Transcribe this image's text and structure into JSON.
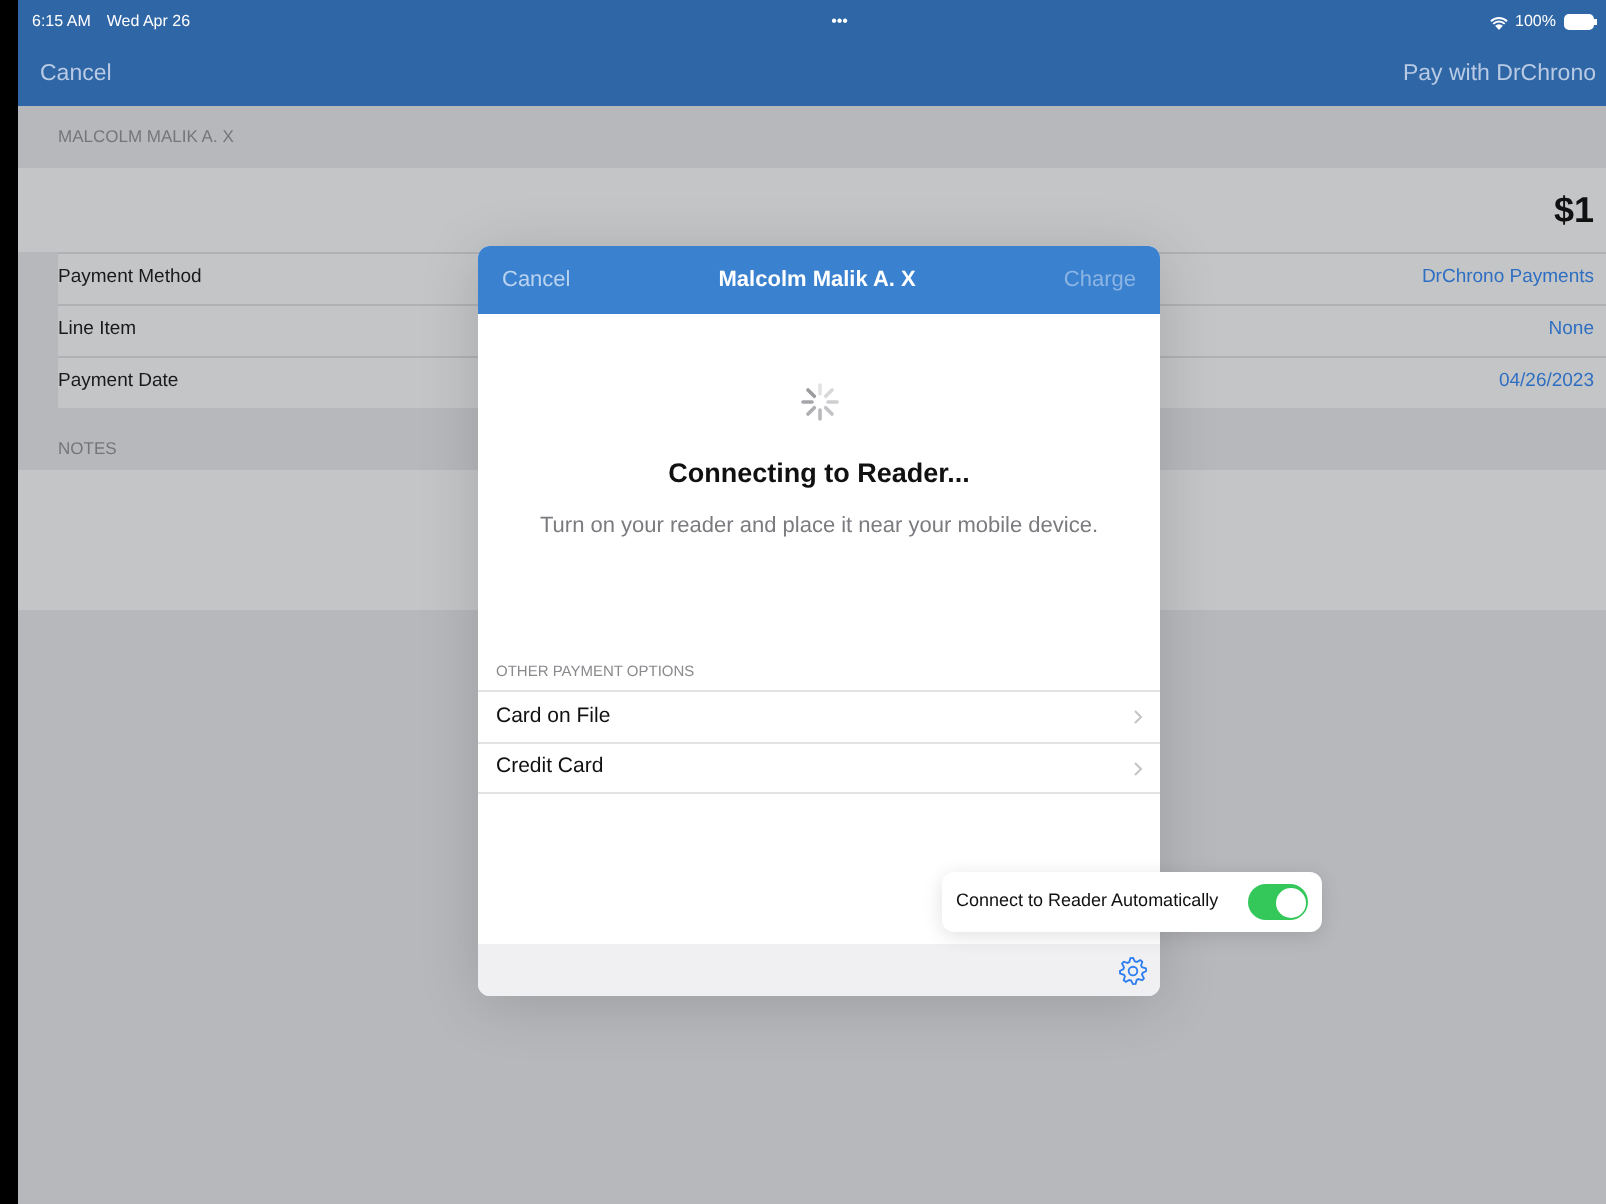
{
  "status_bar": {
    "time": "6:15 AM",
    "date": "Wed Apr 26",
    "dots": "•••",
    "battery": "100%"
  },
  "nav": {
    "cancel": "Cancel",
    "action": "Pay with DrChrono"
  },
  "patient_header": "MALCOLM MALIK A. X",
  "amount": "$1",
  "fields": [
    {
      "label": "Payment Method",
      "value": "DrChrono Payments"
    },
    {
      "label": "Line Item",
      "value": "None"
    },
    {
      "label": "Payment Date",
      "value": "04/26/2023"
    }
  ],
  "notes_header": "NOTES",
  "modal": {
    "cancel": "Cancel",
    "title": "Malcolm Malik A. X",
    "charge": "Charge",
    "charge_disabled": true,
    "heading": "Connecting to Reader...",
    "message": "Turn on your reader and place it near your mobile device.",
    "options_header": "OTHER PAYMENT OPTIONS",
    "options": [
      {
        "label": "Card on File"
      },
      {
        "label": "Credit Card"
      }
    ],
    "popover": {
      "label": "Connect to Reader Automatically",
      "on": true
    }
  }
}
